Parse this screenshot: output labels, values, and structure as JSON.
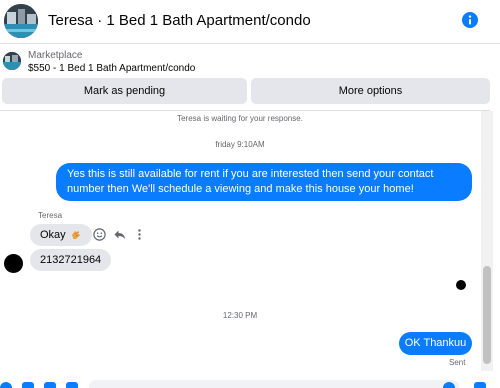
{
  "header": {
    "title": "Teresa · 1 Bed 1 Bath Apartment/condo",
    "info_icon": "info-icon",
    "accent_color": "#0a7cff"
  },
  "listing": {
    "source": "Marketplace",
    "name": "$550 - 1 Bed 1 Bath Apartment/condo",
    "buttons": {
      "mark_pending": "Mark as pending",
      "more_options": "More options"
    }
  },
  "chat": {
    "system_note": "Teresa is waiting for your response.",
    "timestamp_1": "friday 9:10AM",
    "outgoing_1": "Yes this is still available for rent  if you are interested then send your contact number then We'll schedule a viewing and make this house your home!",
    "sender_name": "Teresa",
    "incoming_1": "Okay",
    "incoming_1_emoji": "clapping-hands-icon",
    "incoming_2": "2132721964",
    "timestamp_2": "12:30 PM",
    "outgoing_2": "OK Thankuu",
    "status": "Sent",
    "action_icons": [
      "smile-icon",
      "reply-icon",
      "more-vertical-icon"
    ]
  },
  "colors": {
    "outgoing_bubble": "#0a7cff",
    "incoming_bubble": "#e4e6eb",
    "secondary_text": "#65676b"
  }
}
